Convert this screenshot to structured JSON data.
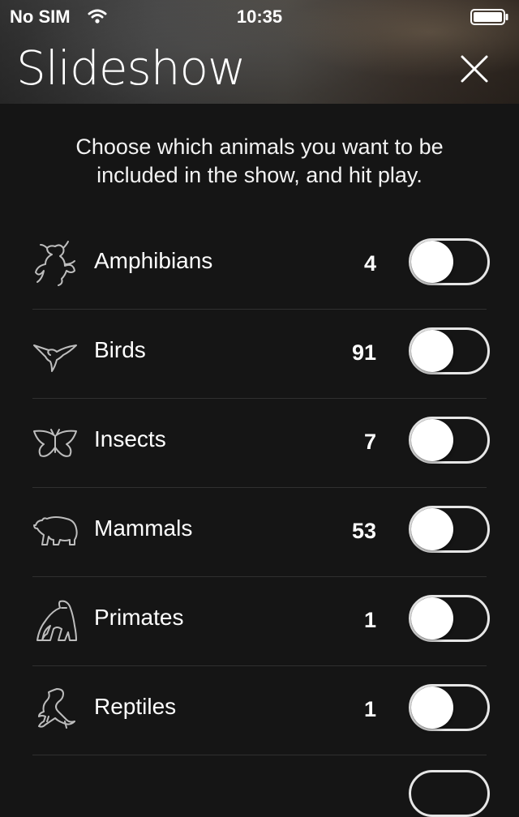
{
  "status_bar": {
    "carrier": "No SIM",
    "time": "10:35"
  },
  "header": {
    "title": "Slideshow"
  },
  "intro": "Choose which animals you want to be included in the show, and hit play.",
  "categories": [
    {
      "label": "Amphibians",
      "count": "4",
      "icon": "frog-icon",
      "enabled": false
    },
    {
      "label": "Birds",
      "count": "91",
      "icon": "hummingbird-icon",
      "enabled": false
    },
    {
      "label": "Insects",
      "count": "7",
      "icon": "butterfly-icon",
      "enabled": false
    },
    {
      "label": "Mammals",
      "count": "53",
      "icon": "bear-icon",
      "enabled": false
    },
    {
      "label": "Primates",
      "count": "1",
      "icon": "gorilla-icon",
      "enabled": false
    },
    {
      "label": "Reptiles",
      "count": "1",
      "icon": "lizard-icon",
      "enabled": false
    }
  ]
}
